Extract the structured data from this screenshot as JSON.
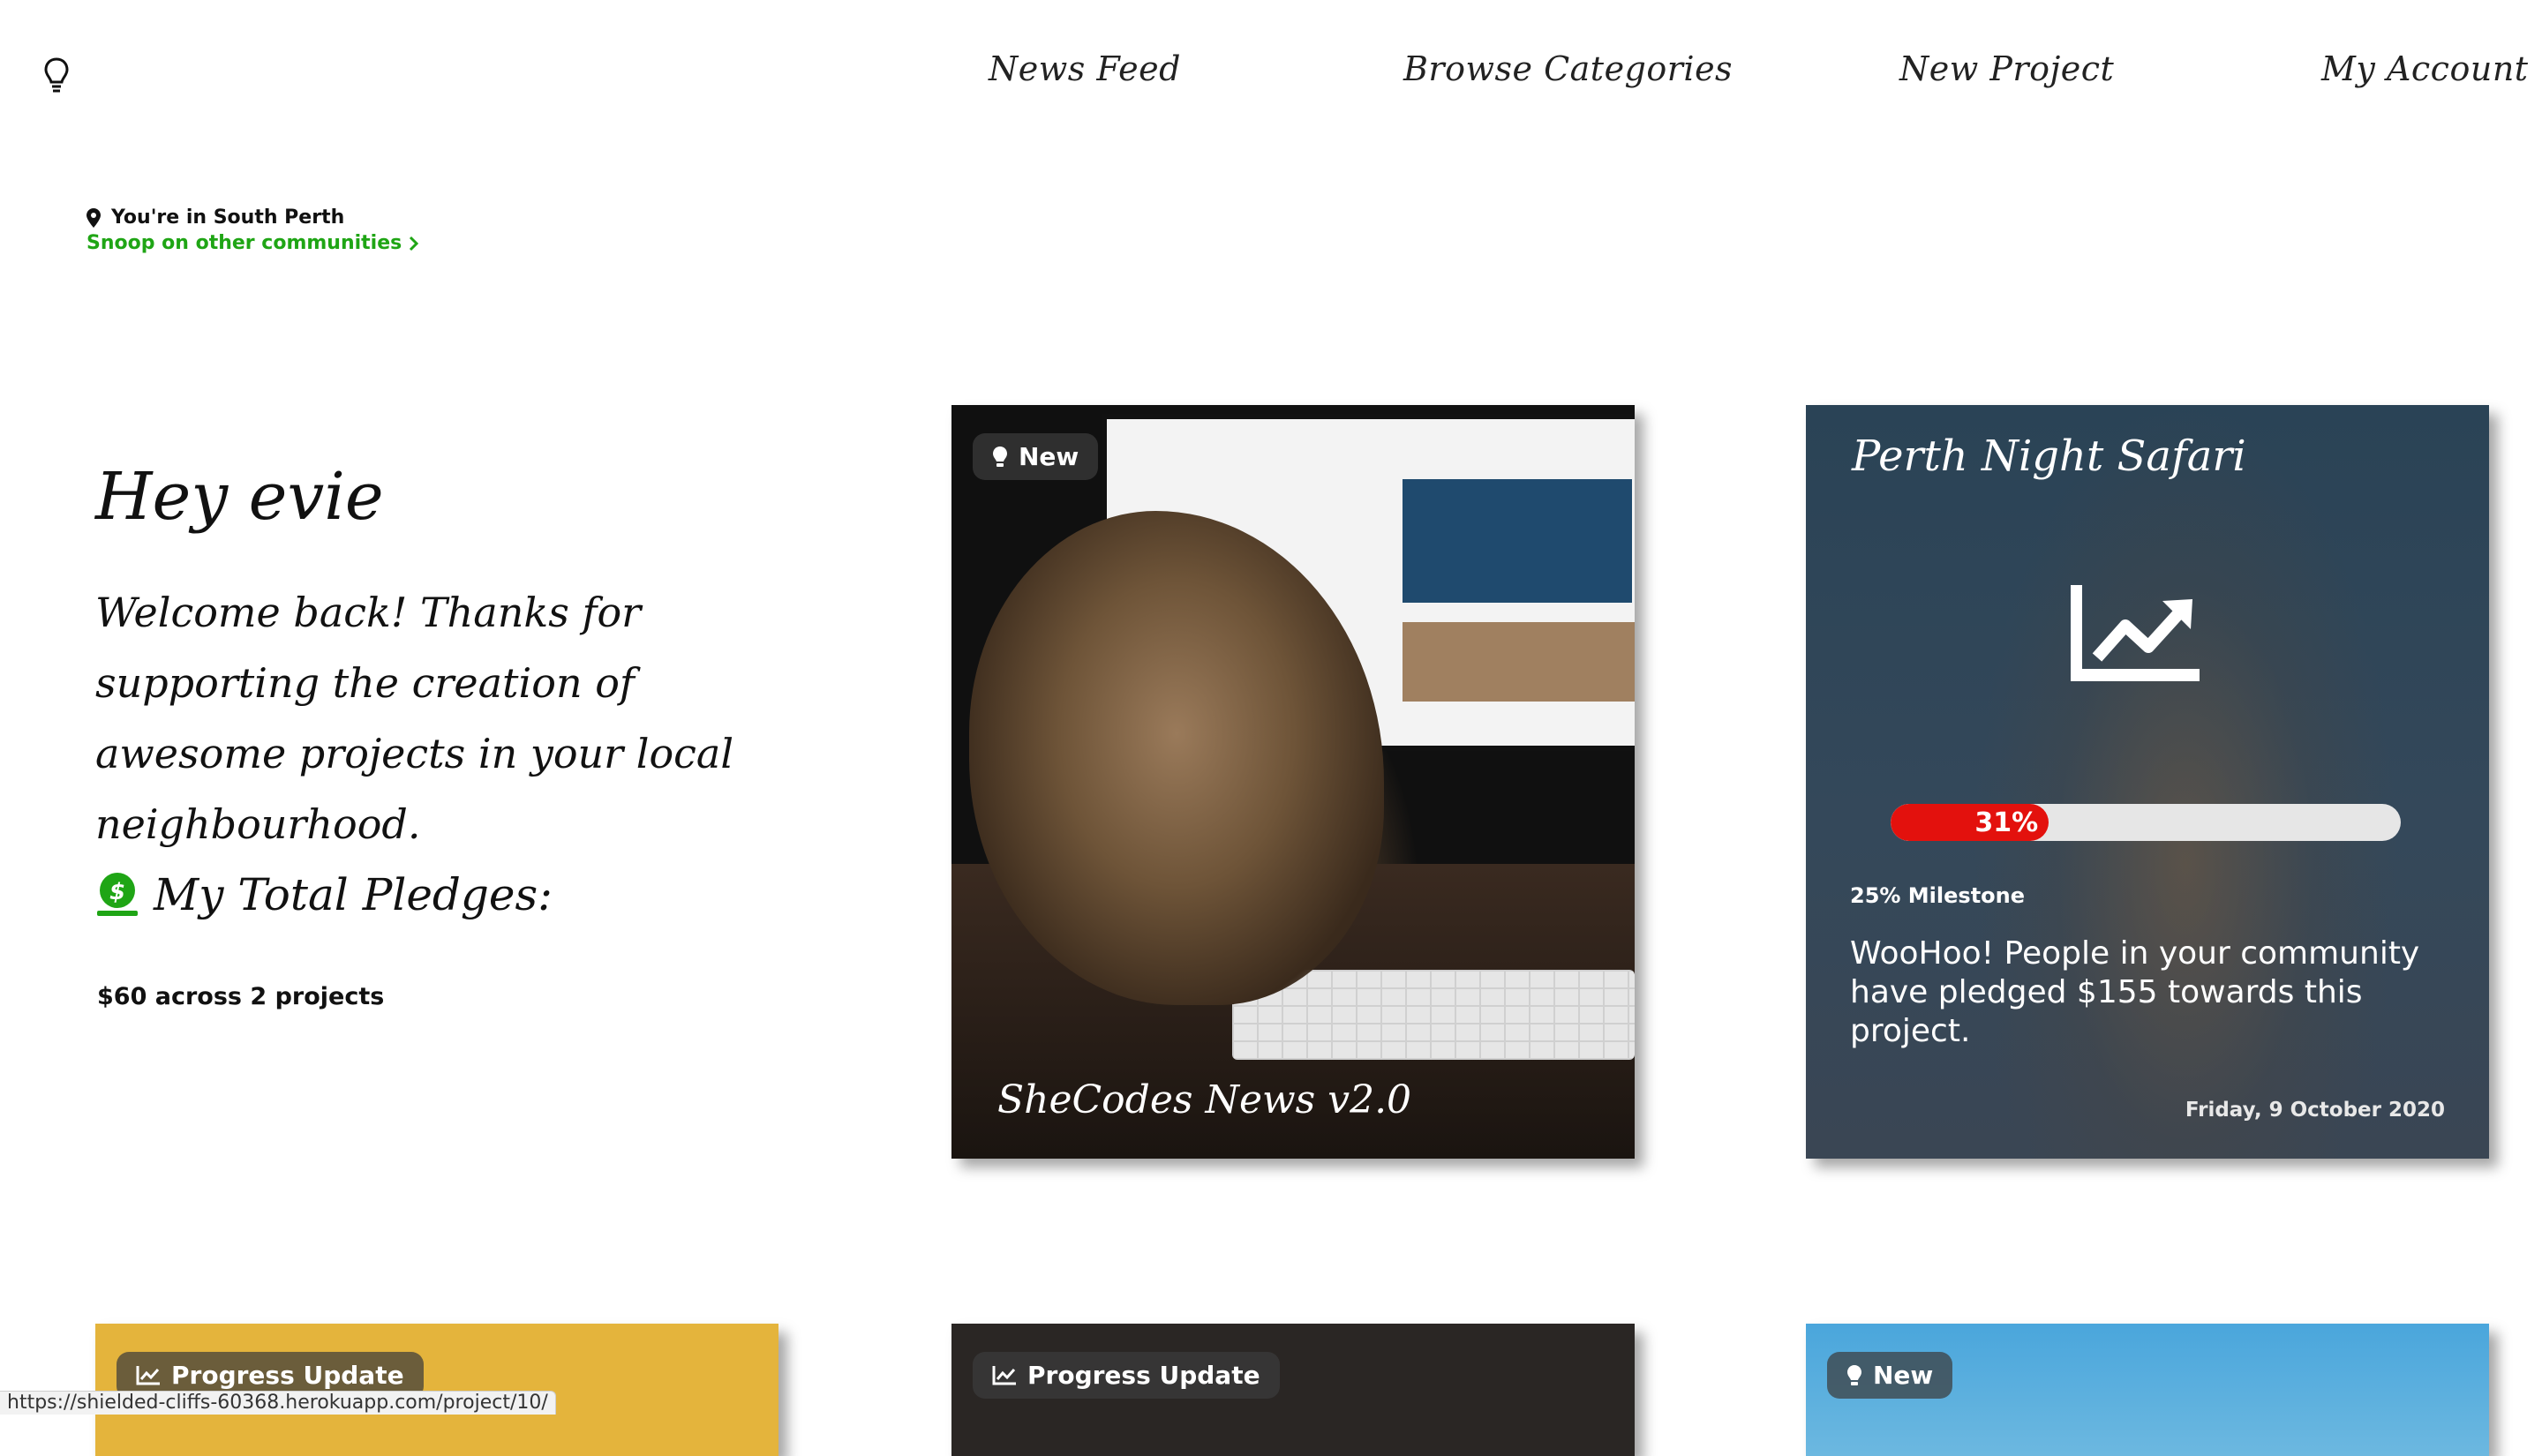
{
  "header": {
    "logo_icon": "lightbulb-icon",
    "nav": [
      "News Feed",
      "Browse Categories",
      "New Project",
      "My Account"
    ]
  },
  "location": {
    "current": "You're in South Perth",
    "link": "Snoop on other communities",
    "link_color": "#1fa515"
  },
  "greeting": {
    "title": "Hey evie",
    "message": "Welcome back! Thanks for supporting the creation of awesome projects in your local neighbourhood.",
    "pledges_heading": "My Total Pledges:",
    "pledges_value": "$60 across 2 projects"
  },
  "cards": [
    {
      "badge": "New",
      "badge_icon": "lightbulb-icon",
      "title": "SheCodes News v2.0"
    },
    {
      "title": "Perth Night Safari",
      "icon": "chart-line-icon",
      "progress_percent": 31,
      "progress_label": "31%",
      "progress_color": "#e3110d",
      "milestone": "25% Milestone",
      "message": "WooHoo! People in your community have pledged $155 towards this project.",
      "date": "Friday, 9 October 2020"
    },
    {
      "badge": "Progress Update",
      "badge_icon": "chart-line-icon"
    },
    {
      "badge": "Progress Update",
      "badge_icon": "chart-line-icon"
    },
    {
      "badge": "New",
      "badge_icon": "lightbulb-icon"
    }
  ],
  "status_bar": {
    "url": "https://shielded-cliffs-60368.herokuapp.com/project/10/"
  }
}
